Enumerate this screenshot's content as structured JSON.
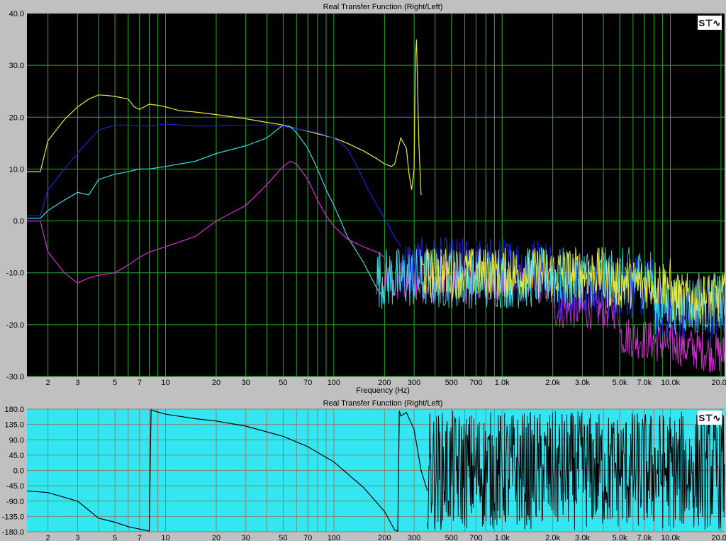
{
  "colors": {
    "frame": "#c0c0c0",
    "plot1_bg": "#000000",
    "plot2_bg": "#33e6f2",
    "grid": "#2ea82e",
    "grid2": "#7a8a7a",
    "trace_yellow": "#e8e83a",
    "trace_blue": "#2020d8",
    "trace_cyan": "#3ad8e0",
    "trace_magenta": "#d030d0",
    "trace_phase": "#000000"
  },
  "icons": {
    "top_toolbar": "spectrum-toggle-icon",
    "bottom_toolbar": "spectrum-toggle-icon"
  },
  "icon_glyph": "S⊤∿",
  "chart_data": [
    {
      "type": "line",
      "title": "Real Transfer Function (Right/Left)",
      "xlabel": "Frequency (Hz)",
      "ylabel": "",
      "x_scale": "log",
      "xlim": [
        1.5,
        21000
      ],
      "ylim": [
        -30,
        40
      ],
      "y_ticks": [
        "40.0",
        "30.0",
        "20.0",
        "10.0",
        "0.0",
        "-10.0",
        "-20.0",
        "-30.0"
      ],
      "x_ticks": [
        {
          "v": 2,
          "l": "2"
        },
        {
          "v": 3,
          "l": "3"
        },
        {
          "v": 5,
          "l": "5"
        },
        {
          "v": 7,
          "l": "7"
        },
        {
          "v": 10,
          "l": "10"
        },
        {
          "v": 20,
          "l": "20"
        },
        {
          "v": 30,
          "l": "30"
        },
        {
          "v": 50,
          "l": "50"
        },
        {
          "v": 70,
          "l": "70"
        },
        {
          "v": 100,
          "l": "100"
        },
        {
          "v": 200,
          "l": "200"
        },
        {
          "v": 300,
          "l": "300"
        },
        {
          "v": 500,
          "l": "500"
        },
        {
          "v": 700,
          "l": "700"
        },
        {
          "v": 1000,
          "l": "1.0k"
        },
        {
          "v": 2000,
          "l": "2.0k"
        },
        {
          "v": 3000,
          "l": "3.0k"
        },
        {
          "v": 5000,
          "l": "5.0k"
        },
        {
          "v": 7000,
          "l": "7.0k"
        },
        {
          "v": 10000,
          "l": "10.0k"
        },
        {
          "v": 20000,
          "l": "20.0k"
        }
      ],
      "grid": true,
      "series": [
        {
          "color": "yellow",
          "x": [
            1.5,
            1.8,
            2,
            2.5,
            3,
            3.5,
            4,
            4.5,
            5,
            6,
            6.5,
            7,
            8,
            9,
            10,
            12,
            15,
            20,
            30,
            40,
            50,
            60,
            70,
            80,
            100,
            120,
            150,
            180,
            200,
            220,
            230,
            250,
            270,
            280,
            290,
            300,
            305,
            310,
            320,
            330
          ],
          "y": [
            9.5,
            9.5,
            15.5,
            19.5,
            22,
            23.5,
            24.3,
            24.2,
            24,
            23.5,
            22,
            21.5,
            22.5,
            22.3,
            22,
            21.3,
            21,
            20.5,
            19.7,
            19,
            18.5,
            17.8,
            17.3,
            16.8,
            16,
            15,
            13.5,
            12,
            11,
            10.5,
            11,
            16,
            14,
            9,
            6,
            10,
            31,
            35,
            15,
            5
          ]
        },
        {
          "color": "blue",
          "x": [
            1.5,
            1.8,
            2,
            2.5,
            3,
            3.5,
            4,
            5,
            6,
            7,
            8,
            10,
            15,
            20,
            30,
            40,
            50,
            60,
            80,
            100,
            120,
            140,
            160,
            180,
            200,
            220,
            250
          ],
          "y": [
            1,
            1,
            6,
            10,
            13,
            15.5,
            17.5,
            18.5,
            18.5,
            18.3,
            18.3,
            18.7,
            18.3,
            18.3,
            18.5,
            18.5,
            18.2,
            17.8,
            17,
            16,
            14,
            10,
            6,
            3,
            0.5,
            -2,
            -5
          ]
        },
        {
          "color": "cyan",
          "x": [
            1.5,
            1.8,
            2,
            2.5,
            3,
            3.5,
            4,
            5,
            6,
            7,
            8,
            10,
            15,
            20,
            30,
            40,
            50,
            55,
            60,
            70,
            80,
            90,
            100,
            110,
            120,
            150,
            180,
            200
          ],
          "y": [
            0.5,
            0.5,
            2,
            4,
            5.5,
            5,
            8,
            9,
            9.5,
            10,
            10,
            10.5,
            11.5,
            13,
            14.5,
            16,
            18.5,
            18.2,
            17,
            14,
            10,
            6,
            3,
            0,
            -3,
            -8,
            -13,
            -15
          ]
        },
        {
          "color": "magenta",
          "x": [
            1.5,
            1.8,
            2,
            2.5,
            3,
            3.5,
            4,
            5,
            6,
            7,
            8,
            10,
            15,
            20,
            30,
            40,
            50,
            55,
            60,
            70,
            80,
            90,
            100,
            120,
            150,
            180,
            200
          ],
          "y": [
            0,
            0,
            -6,
            -10,
            -12,
            -11,
            -10.5,
            -10,
            -8.5,
            -7,
            -6,
            -5,
            -3,
            0,
            3,
            7,
            10.5,
            11.5,
            11,
            8,
            4,
            1,
            -1,
            -3.5,
            -5,
            -6,
            -7
          ]
        }
      ]
    },
    {
      "type": "line",
      "title": "Real Transfer Function (Right/Left)",
      "xlabel": "",
      "ylabel": "",
      "x_scale": "log",
      "xlim": [
        1.5,
        21000
      ],
      "ylim": [
        -180,
        180
      ],
      "y_ticks": [
        "180.0",
        "135.0",
        "90.0",
        "45.0",
        "0.0",
        "-45.0",
        "-90.0",
        "-135.0",
        "-180.0"
      ],
      "x_ticks": [
        {
          "v": 2,
          "l": "2"
        },
        {
          "v": 3,
          "l": "3"
        },
        {
          "v": 5,
          "l": "5"
        },
        {
          "v": 7,
          "l": "7"
        },
        {
          "v": 10,
          "l": "10"
        },
        {
          "v": 20,
          "l": "20"
        },
        {
          "v": 30,
          "l": "30"
        },
        {
          "v": 50,
          "l": "50"
        },
        {
          "v": 70,
          "l": "70"
        },
        {
          "v": 100,
          "l": "100"
        },
        {
          "v": 200,
          "l": "200"
        },
        {
          "v": 300,
          "l": "300"
        },
        {
          "v": 500,
          "l": "500"
        },
        {
          "v": 700,
          "l": "700"
        },
        {
          "v": 1000,
          "l": "1.0k"
        },
        {
          "v": 2000,
          "l": "2.0k"
        },
        {
          "v": 3000,
          "l": "3.0k"
        },
        {
          "v": 5000,
          "l": "5.0k"
        },
        {
          "v": 7000,
          "l": "7.0k"
        },
        {
          "v": 10000,
          "l": "10.0k"
        },
        {
          "v": 20000,
          "l": "20.0k"
        }
      ],
      "grid": true,
      "series": [
        {
          "color": "black",
          "x": [
            1.5,
            2,
            3,
            4,
            5,
            6,
            7,
            8,
            8.2,
            8.5,
            10,
            15,
            20,
            30,
            50,
            70,
            100,
            150,
            200,
            230,
            240,
            245,
            250,
            270,
            300,
            330,
            360
          ],
          "y": [
            -60,
            -65,
            -90,
            -140,
            -152,
            -165,
            -172,
            -178,
            178,
            175,
            165,
            152,
            145,
            130,
            100,
            70,
            25,
            -50,
            -120,
            -175,
            -178,
            175,
            160,
            170,
            120,
            0,
            -60
          ]
        }
      ]
    }
  ]
}
